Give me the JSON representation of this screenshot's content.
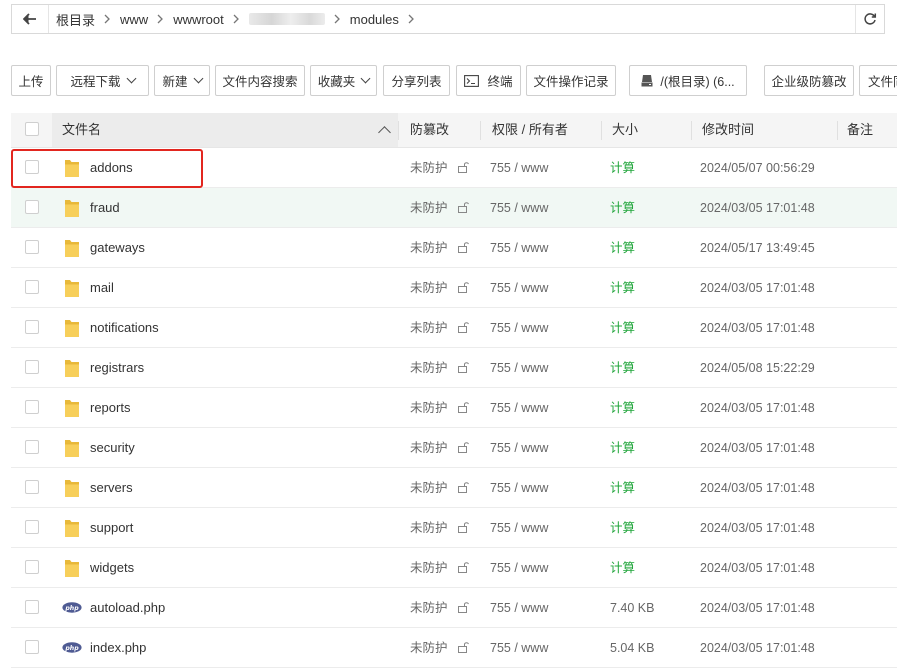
{
  "breadcrumb": {
    "items": [
      "根目录",
      "www",
      "wwwroot",
      "modules"
    ],
    "redacted_segment": true
  },
  "toolbar": {
    "upload": "上传",
    "remote_download": "远程下载",
    "new": "新建",
    "content_search": "文件内容搜索",
    "favorites": "收藏夹",
    "share_list": "分享列表",
    "terminal": "终端",
    "operation_log": "文件操作记录",
    "disk": "/(根目录) (6...",
    "tamper_proof": "企业级防篡改",
    "file_sync": "文件同步"
  },
  "table": {
    "headers": {
      "name": "文件名",
      "protect": "防篡改",
      "permission": "权限 / 所有者",
      "size": "大小",
      "mtime": "修改时间",
      "remark": "备注"
    },
    "rows": [
      {
        "name": "addons",
        "type": "folder",
        "protect": "未防护",
        "perm": "755 / www",
        "size": "计算",
        "mtime": "2024/05/07 00:56:29"
      },
      {
        "name": "fraud",
        "type": "folder",
        "protect": "未防护",
        "perm": "755 / www",
        "size": "计算",
        "mtime": "2024/03/05 17:01:48"
      },
      {
        "name": "gateways",
        "type": "folder",
        "protect": "未防护",
        "perm": "755 / www",
        "size": "计算",
        "mtime": "2024/05/17 13:49:45"
      },
      {
        "name": "mail",
        "type": "folder",
        "protect": "未防护",
        "perm": "755 / www",
        "size": "计算",
        "mtime": "2024/03/05 17:01:48"
      },
      {
        "name": "notifications",
        "type": "folder",
        "protect": "未防护",
        "perm": "755 / www",
        "size": "计算",
        "mtime": "2024/03/05 17:01:48"
      },
      {
        "name": "registrars",
        "type": "folder",
        "protect": "未防护",
        "perm": "755 / www",
        "size": "计算",
        "mtime": "2024/05/08 15:22:29"
      },
      {
        "name": "reports",
        "type": "folder",
        "protect": "未防护",
        "perm": "755 / www",
        "size": "计算",
        "mtime": "2024/03/05 17:01:48"
      },
      {
        "name": "security",
        "type": "folder",
        "protect": "未防护",
        "perm": "755 / www",
        "size": "计算",
        "mtime": "2024/03/05 17:01:48"
      },
      {
        "name": "servers",
        "type": "folder",
        "protect": "未防护",
        "perm": "755 / www",
        "size": "计算",
        "mtime": "2024/03/05 17:01:48"
      },
      {
        "name": "support",
        "type": "folder",
        "protect": "未防护",
        "perm": "755 / www",
        "size": "计算",
        "mtime": "2024/03/05 17:01:48"
      },
      {
        "name": "widgets",
        "type": "folder",
        "protect": "未防护",
        "perm": "755 / www",
        "size": "计算",
        "mtime": "2024/03/05 17:01:48"
      },
      {
        "name": "autoload.php",
        "type": "php",
        "protect": "未防护",
        "perm": "755 / www",
        "size": "7.40 KB",
        "mtime": "2024/03/05 17:01:48"
      },
      {
        "name": "index.php",
        "type": "php",
        "protect": "未防护",
        "perm": "755 / www",
        "size": "5.04 KB",
        "mtime": "2024/03/05 17:01:48"
      }
    ]
  },
  "colors": {
    "accent_green": "#20a53a",
    "highlight_red": "#e2261f",
    "hover_row": "#f1f8f4",
    "folder_yellow": "#f5c94c",
    "php_blue": "#4f5b93"
  },
  "icons": [
    "back-arrow-icon",
    "refresh-icon",
    "terminal-icon",
    "disk-icon",
    "folder-icon",
    "php-file-icon",
    "unlock-icon",
    "chevron-right-icon",
    "caret-down-icon",
    "sort-up-icon"
  ]
}
